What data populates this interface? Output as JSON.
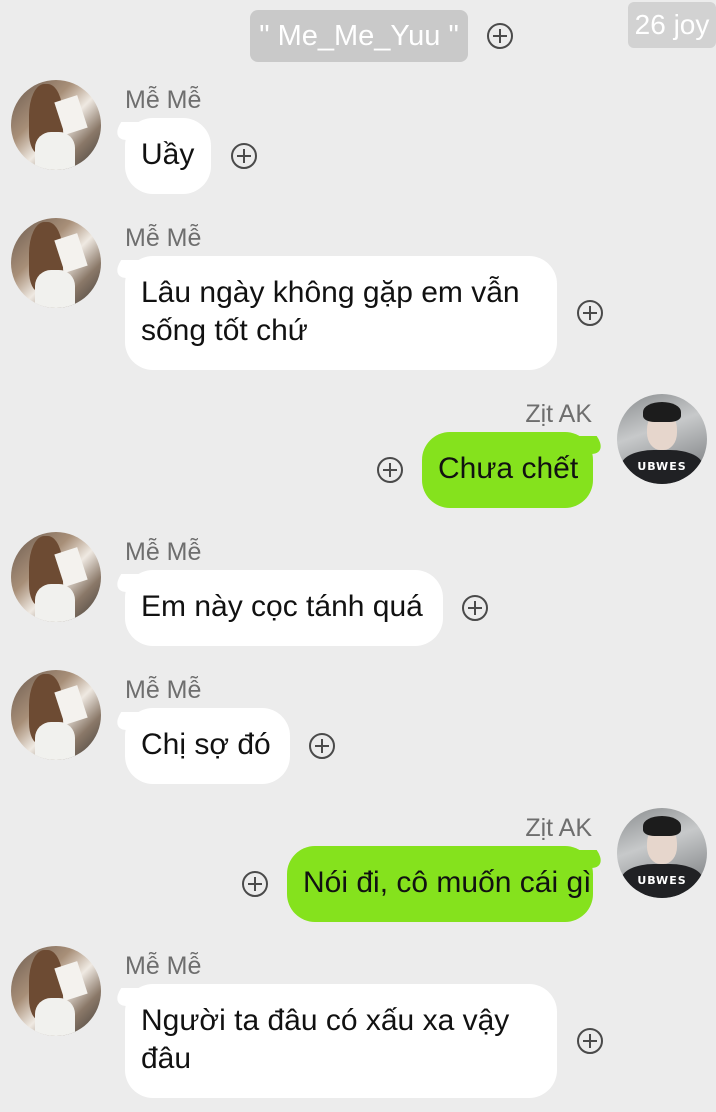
{
  "header": {
    "chat_title": "\" Me_Me_Yuu \"",
    "corner_badge": "26 joy"
  },
  "participants": {
    "incoming_name": "Mễ Mễ",
    "outgoing_name": "Zịt AK",
    "outgoing_avatar_print": "UBWES"
  },
  "messages": [
    {
      "sender": "Mễ Mễ",
      "text": "Uầy"
    },
    {
      "sender": "Mễ Mễ",
      "text": "Lâu ngày không gặp em vẫn sống tốt chứ"
    },
    {
      "sender": "Zịt AK",
      "text": "Chưa chết"
    },
    {
      "sender": "Mễ Mễ",
      "text": "Em này cọc tánh quá"
    },
    {
      "sender": "Mễ Mễ",
      "text": "Chị sợ đó"
    },
    {
      "sender": "Zịt AK",
      "text": "Nói đi, cô muốn cái gì"
    },
    {
      "sender": "Mễ Mễ",
      "text": "Người ta đâu có xấu xa vậy đâu"
    }
  ],
  "colors": {
    "background": "#ececec",
    "incoming_bubble": "#ffffff",
    "outgoing_bubble": "#85e21d",
    "name_text": "#6e6e6e"
  }
}
